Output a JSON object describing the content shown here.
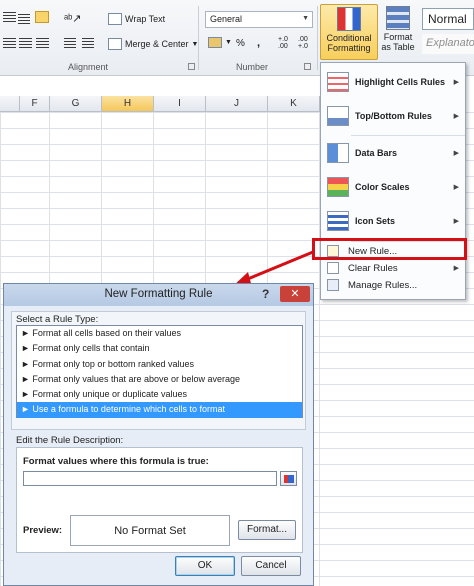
{
  "ribbon": {
    "wrap_text": "Wrap Text",
    "merge_center": "Merge & Center",
    "number_format": "General",
    "alignment_label": "Alignment",
    "number_label": "Number",
    "currency_symbol": "%",
    "comma_symbol": ",",
    "inc_decimal": "+.0 .00",
    "dec_decimal": ".00 +.0",
    "conditional_formatting": "Conditional Formatting",
    "format_as_table": "Format as Table",
    "style_normal": "Normal",
    "style_explanatory": "Explanato"
  },
  "sheet": {
    "columns": [
      "F",
      "G",
      "H",
      "I",
      "J",
      "K"
    ]
  },
  "menu": {
    "items": [
      {
        "label": "Highlight Cells Rules"
      },
      {
        "label": "Top/Bottom Rules"
      },
      {
        "label": "Data Bars"
      },
      {
        "label": "Color Scales"
      },
      {
        "label": "Icon Sets"
      },
      {
        "label": "New Rule..."
      },
      {
        "label": "Clear Rules"
      },
      {
        "label": "Manage Rules..."
      }
    ]
  },
  "dialog": {
    "title": "New Formatting Rule",
    "help": "?",
    "close": "✕",
    "select_rule_type": "Select a Rule Type:",
    "rules": [
      "► Format all cells based on their values",
      "► Format only cells that contain",
      "► Format only top or bottom ranked values",
      "► Format only values that are above or below average",
      "► Format only unique or duplicate values",
      "► Use a formula to determine which cells to format"
    ],
    "edit_description": "Edit the Rule Description:",
    "formula_label": "Format values where this formula is true:",
    "formula_value": "",
    "preview_label": "Preview:",
    "preview_text": "No Format Set",
    "format_button": "Format...",
    "ok_button": "OK",
    "cancel_button": "Cancel"
  },
  "colors": {
    "highlight": "#d40f16",
    "selection": "#3399ff"
  }
}
